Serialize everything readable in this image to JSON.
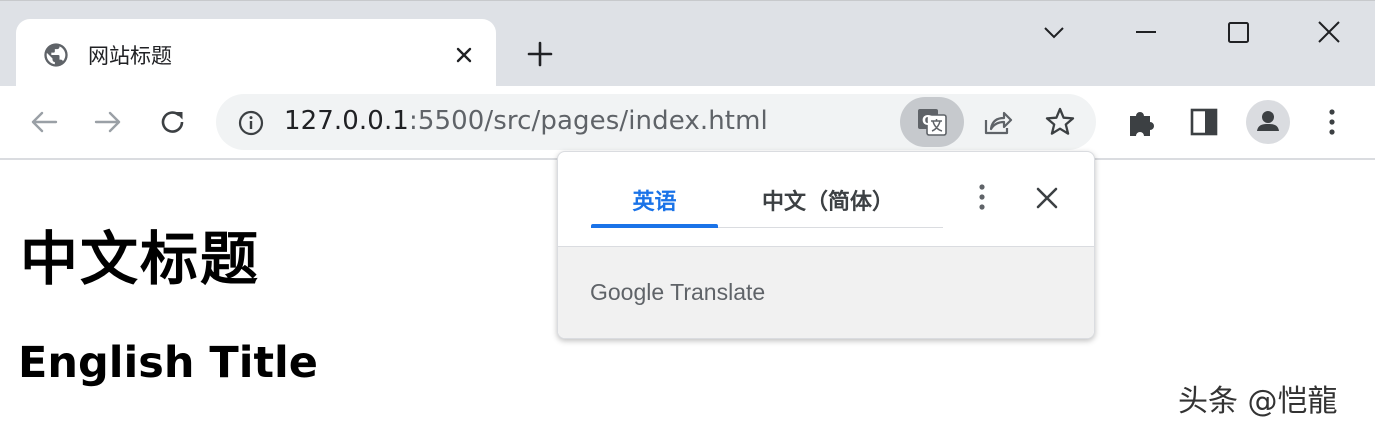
{
  "browser": {
    "tab": {
      "title": "网站标题",
      "favicon": "globe-icon"
    },
    "window_controls": [
      "chevron-down-icon",
      "minimize-icon",
      "maximize-icon",
      "close-icon"
    ],
    "address_bar": {
      "host": "127.0.0.1",
      "path": ":5500/src/pages/index.html"
    },
    "toolbar_icons": [
      "back-icon",
      "forward-icon",
      "reload-icon",
      "info-icon",
      "translate-icon",
      "share-icon",
      "star-icon",
      "puzzle-icon",
      "side-panel-icon",
      "profile-icon",
      "kebab-menu-icon"
    ]
  },
  "page": {
    "h1": "中文标题",
    "h2": "English Title"
  },
  "translate_bubble": {
    "source_tab": "英语",
    "target_tab": "中文（简体）",
    "brand": {
      "google": "Google",
      "translate": "Translate"
    }
  },
  "watermark": "头条 @恺龍",
  "colors": {
    "accent": "#1a73e8",
    "tabstrip": "#dee1e6",
    "omnibox": "#f1f3f4"
  }
}
